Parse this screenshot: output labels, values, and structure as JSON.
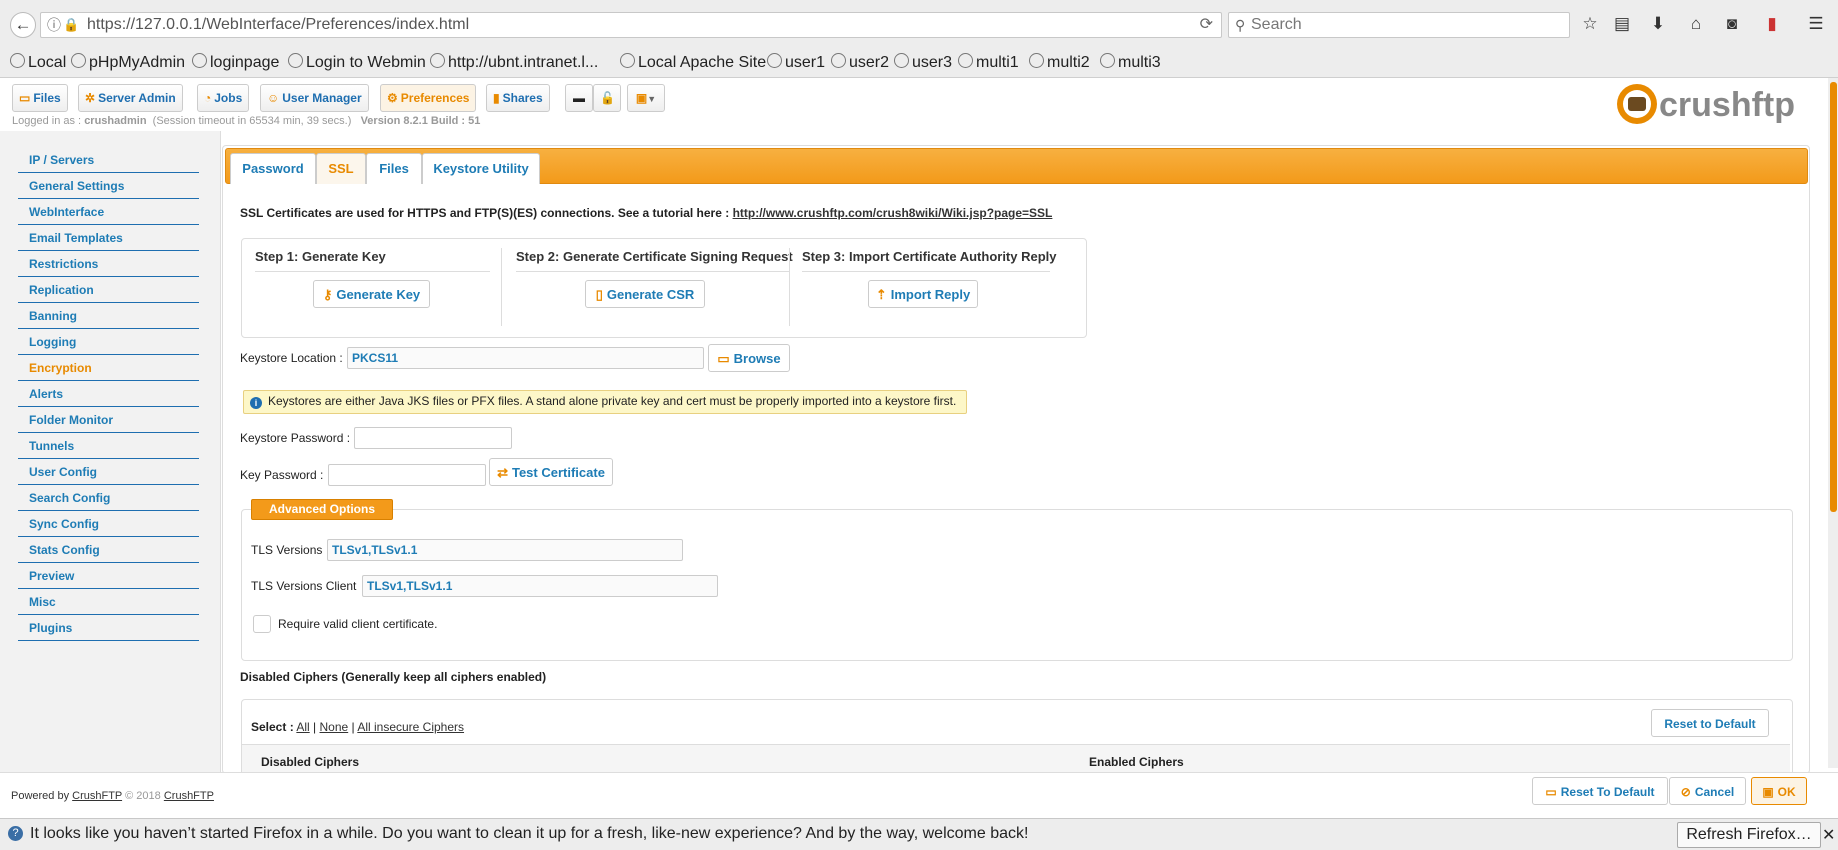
{
  "browser": {
    "url": "https://127.0.0.1/WebInterface/Preferences/index.html",
    "search_placeholder": "Search",
    "bookmarks": [
      "Local",
      "pHpMyAdmin",
      "loginpage",
      "Login to Webmin",
      "http://ubnt.intranet.l...",
      "Local Apache Site",
      "user1",
      "user2",
      "user3",
      "multi1",
      "multi2",
      "multi3"
    ]
  },
  "toolbar": {
    "files": "Files",
    "server_admin": "Server Admin",
    "jobs": "Jobs",
    "user_manager": "User Manager",
    "preferences": "Preferences",
    "shares": "Shares"
  },
  "session": {
    "prefix": "Logged in as :",
    "user": "crushadmin",
    "timeout": "(Session timeout in 65534 min, 39 secs.)",
    "version": "Version 8.2.1 Build : 51"
  },
  "logo": {
    "text": "crushftp"
  },
  "sidebar": {
    "items": [
      {
        "label": "IP / Servers"
      },
      {
        "label": "General Settings"
      },
      {
        "label": "WebInterface"
      },
      {
        "label": "Email Templates"
      },
      {
        "label": "Restrictions"
      },
      {
        "label": "Replication"
      },
      {
        "label": "Banning"
      },
      {
        "label": "Logging"
      },
      {
        "label": "Encryption"
      },
      {
        "label": "Alerts"
      },
      {
        "label": "Folder Monitor"
      },
      {
        "label": "Tunnels"
      },
      {
        "label": "User Config"
      },
      {
        "label": "Search Config"
      },
      {
        "label": "Sync Config"
      },
      {
        "label": "Stats Config"
      },
      {
        "label": "Preview"
      },
      {
        "label": "Misc"
      },
      {
        "label": "Plugins"
      }
    ],
    "active": "Encryption"
  },
  "tabs": [
    "Password",
    "SSL",
    "Files",
    "Keystore Utility"
  ],
  "active_tab": "SSL",
  "ssl": {
    "intro": "SSL Certificates are used for HTTPS and FTP(S)(ES) connections. See a tutorial here :",
    "intro_link": "http://www.crushftp.com/crush8wiki/Wiki.jsp?page=SSL",
    "step1_title": "Step 1: Generate Key",
    "step1_button": "Generate Key",
    "step2_title": "Step 2: Generate Certificate Signing Request",
    "step2_button": "Generate CSR",
    "step3_title": "Step 3: Import Certificate Authority Reply",
    "step3_button": "Import Reply",
    "keystore_location_label": "Keystore Location :",
    "keystore_location_value": "PKCS11",
    "browse": "Browse",
    "notice": "Keystores are either Java JKS files or PFX files. A stand alone private key and cert must be properly imported into a keystore first.",
    "keystore_password_label": "Keystore Password :",
    "key_password_label": "Key Password :",
    "test_certificate": "Test Certificate",
    "advanced_options": "Advanced Options",
    "tls_versions_label": "TLS Versions",
    "tls_versions_value": "TLSv1,TLSv1.1",
    "tls_versions_client_label": "TLS Versions Client",
    "tls_versions_client_value": "TLSv1,TLSv1.1",
    "require_client_cert": "Require valid client certificate.",
    "disabled_ciphers_heading": "Disabled Ciphers (Generally keep all ciphers enabled)",
    "select_label": "Select :",
    "select_all": "All",
    "select_none": "None",
    "select_insecure": "All insecure Ciphers",
    "reset_to_default": "Reset to Default",
    "col_disabled": "Disabled Ciphers",
    "col_enabled": "Enabled Ciphers"
  },
  "footer": {
    "powered_by": "Powered by",
    "brand": "CrushFTP",
    "copyright": "© 2018",
    "brand2": "CrushFTP",
    "reset": "Reset To Default",
    "cancel": "Cancel",
    "ok": "OK"
  },
  "notification": {
    "text": "It looks like you haven’t started Firefox in a while. Do you want to clean it up for a fresh, like-new experience? And by the way, welcome back!",
    "button": "Refresh Firefox…"
  }
}
